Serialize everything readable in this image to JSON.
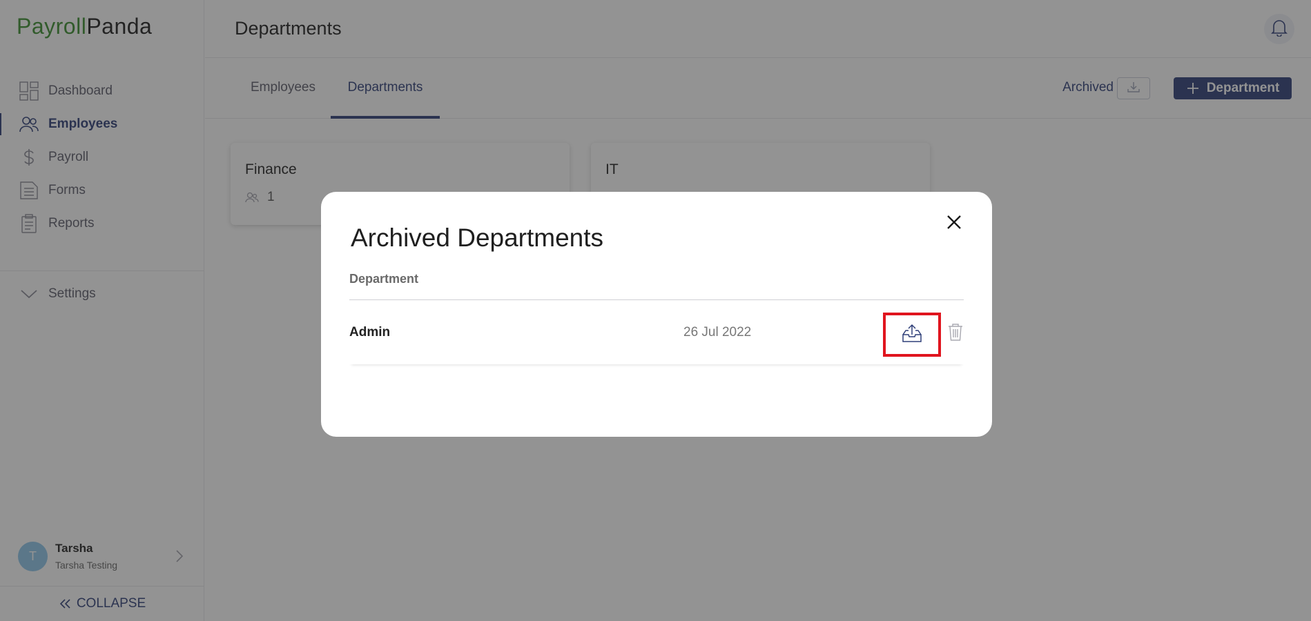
{
  "app": {
    "logo_part1": "Payroll",
    "logo_part2": "Panda"
  },
  "sidebar": {
    "items": [
      {
        "label": "Dashboard",
        "icon": "dashboard-icon",
        "active": false
      },
      {
        "label": "Employees",
        "icon": "users-icon",
        "active": true
      },
      {
        "label": "Payroll",
        "icon": "dollar-icon",
        "active": false
      },
      {
        "label": "Forms",
        "icon": "document-icon",
        "active": false
      },
      {
        "label": "Reports",
        "icon": "clipboard-icon",
        "active": false
      }
    ],
    "settings_label": "Settings",
    "user": {
      "initial": "T",
      "name": "Tarsha",
      "subtitle": "Tarsha Testing"
    },
    "collapse_label": "COLLAPSE"
  },
  "header": {
    "title": "Departments"
  },
  "tabs": [
    {
      "label": "Employees",
      "active": false
    },
    {
      "label": "Departments",
      "active": true
    }
  ],
  "toolbar": {
    "archived_label": "Archived",
    "add_label": "Department"
  },
  "cards": [
    {
      "title": "Finance",
      "count": "1"
    },
    {
      "title": "IT",
      "count": ""
    }
  ],
  "modal": {
    "title": "Archived Departments",
    "column_header": "Department",
    "rows": [
      {
        "name": "Admin",
        "date": "26 Jul 2022"
      }
    ]
  },
  "colors": {
    "brand_green": "#3a8f2e",
    "accent_navy": "#2f3f78",
    "highlight_red": "#e0141e"
  }
}
